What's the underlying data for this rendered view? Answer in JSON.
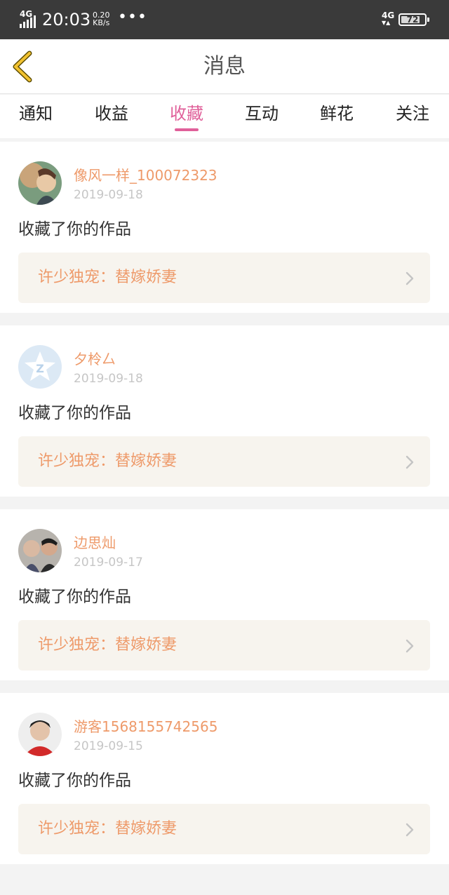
{
  "status_bar": {
    "network": "4G",
    "time": "20:03",
    "speed_value": "0.20",
    "speed_unit": "KB/s",
    "more": "•••",
    "network2": "4G",
    "battery": "72"
  },
  "header": {
    "title": "消息"
  },
  "tabs": [
    {
      "label": "通知"
    },
    {
      "label": "收益"
    },
    {
      "label": "收藏"
    },
    {
      "label": "互动"
    },
    {
      "label": "鲜花"
    },
    {
      "label": "关注"
    }
  ],
  "active_tab": "收藏",
  "colors": {
    "accent_pink": "#e0609a",
    "username_orange": "#ee9a6a",
    "work_box_bg": "#f7f4ee"
  },
  "messages": [
    {
      "username": "像风一样_100072323",
      "date": "2019-09-18",
      "action": "收藏了你的作品",
      "work_title": "许少独宠：替嫁娇妻",
      "avatar": "user-photo-avatar"
    },
    {
      "username": "夕柃厶",
      "date": "2019-09-18",
      "action": "收藏了你的作品",
      "work_title": "许少独宠：替嫁娇妻",
      "avatar": "default-star-avatar"
    },
    {
      "username": "边思灿",
      "date": "2019-09-17",
      "action": "收藏了你的作品",
      "work_title": "许少独宠：替嫁娇妻",
      "avatar": "user-photo-avatar"
    },
    {
      "username": "游客1568155742565",
      "date": "2019-09-15",
      "action": "收藏了你的作品",
      "work_title": "许少独宠：替嫁娇妻",
      "avatar": "user-photo-avatar"
    }
  ]
}
